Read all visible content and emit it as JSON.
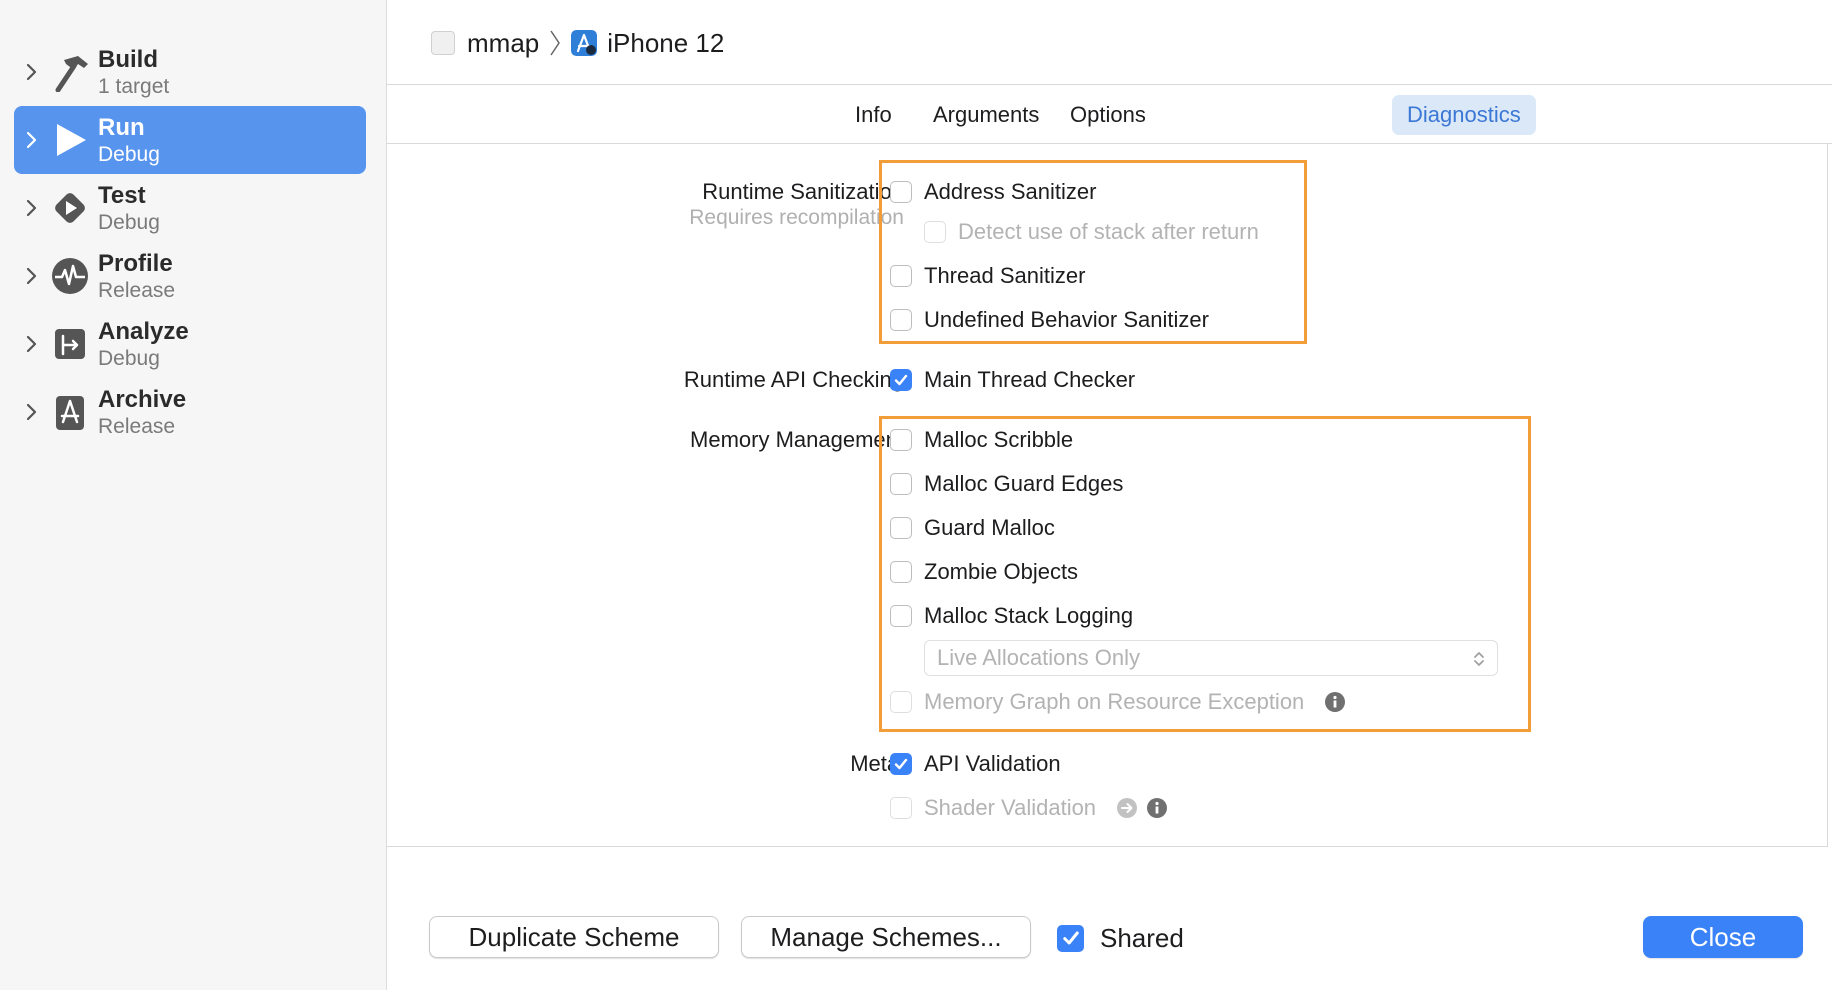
{
  "sidebar": {
    "items": [
      {
        "name": "Build",
        "sub": "1 target",
        "icon": "hammer-icon"
      },
      {
        "name": "Run",
        "sub": "Debug",
        "icon": "play-icon",
        "selected": true
      },
      {
        "name": "Test",
        "sub": "Debug",
        "icon": "test-diamond-icon"
      },
      {
        "name": "Profile",
        "sub": "Release",
        "icon": "waveform-icon"
      },
      {
        "name": "Analyze",
        "sub": "Debug",
        "icon": "analyze-icon"
      },
      {
        "name": "Archive",
        "sub": "Release",
        "icon": "archive-icon"
      }
    ]
  },
  "breadcrumb": {
    "project": "mmap",
    "device": "iPhone 12"
  },
  "tabs": [
    {
      "label": "Info"
    },
    {
      "label": "Arguments"
    },
    {
      "label": "Options"
    },
    {
      "label": "Diagnostics",
      "active": true
    }
  ],
  "diagnostics": {
    "runtime_sanitization": {
      "label": "Runtime Sanitization",
      "sublabel": "Requires recompilation",
      "address_sanitizer": "Address Sanitizer",
      "detect_stack": "Detect use of stack after return",
      "thread_sanitizer": "Thread Sanitizer",
      "ub_sanitizer": "Undefined Behavior Sanitizer"
    },
    "runtime_api": {
      "label": "Runtime API Checking",
      "main_thread_checker": "Main Thread Checker"
    },
    "memory": {
      "label": "Memory Management",
      "malloc_scribble": "Malloc Scribble",
      "malloc_guard_edges": "Malloc Guard Edges",
      "guard_malloc": "Guard Malloc",
      "zombie_objects": "Zombie Objects",
      "malloc_stack_logging": "Malloc Stack Logging",
      "stack_logging_mode": "Live Allocations Only",
      "memory_graph": "Memory Graph on Resource Exception"
    },
    "metal": {
      "label": "Metal",
      "api_validation": "API Validation",
      "shader_validation": "Shader Validation"
    }
  },
  "footer": {
    "duplicate": "Duplicate Scheme",
    "manage": "Manage Schemes...",
    "shared": "Shared",
    "close": "Close"
  },
  "colors": {
    "accent": "#3a82f7",
    "sidebar_selected": "#5794ee",
    "highlight_box": "#f29d38",
    "active_tab_bg": "#dbe8f8"
  }
}
